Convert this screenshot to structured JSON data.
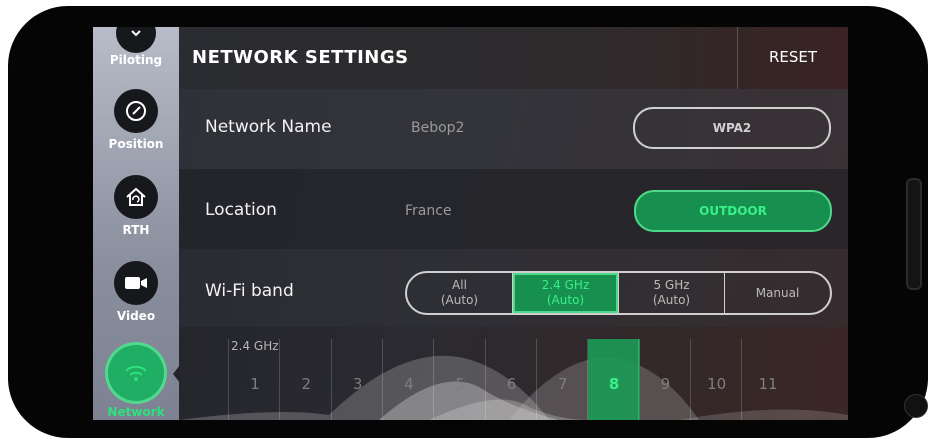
{
  "sidebar": {
    "items": [
      {
        "label": "Piloting",
        "icon": "chevron-down-icon"
      },
      {
        "label": "Position",
        "icon": "gauge-icon"
      },
      {
        "label": "RTH",
        "icon": "home-icon"
      },
      {
        "label": "Video",
        "icon": "video-camera-icon"
      },
      {
        "label": "Network",
        "icon": "wifi-icon",
        "active": true
      }
    ]
  },
  "header": {
    "title": "NETWORK SETTINGS",
    "reset_label": "RESET"
  },
  "network_name": {
    "label": "Network Name",
    "value": "Bebop2",
    "security_button": "WPA2"
  },
  "location": {
    "label": "Location",
    "value": "France",
    "mode_button": "OUTDOOR"
  },
  "wifi_band": {
    "label": "Wi-Fi band",
    "options": [
      {
        "label": "All\n(Auto)",
        "selected": false
      },
      {
        "label": "2.4 GHz\n(Auto)",
        "selected": true
      },
      {
        "label": "5 GHz\n(Auto)",
        "selected": false
      },
      {
        "label": "Manual",
        "selected": false
      }
    ]
  },
  "channels": {
    "band_label": "2.4 GHz",
    "numbers": [
      "1",
      "2",
      "3",
      "4",
      "5",
      "6",
      "7",
      "8",
      "9",
      "10",
      "11"
    ],
    "selected": "8"
  },
  "colors": {
    "accent": "#1fae63",
    "accent_text": "#39f08a",
    "background": "#26272d"
  }
}
